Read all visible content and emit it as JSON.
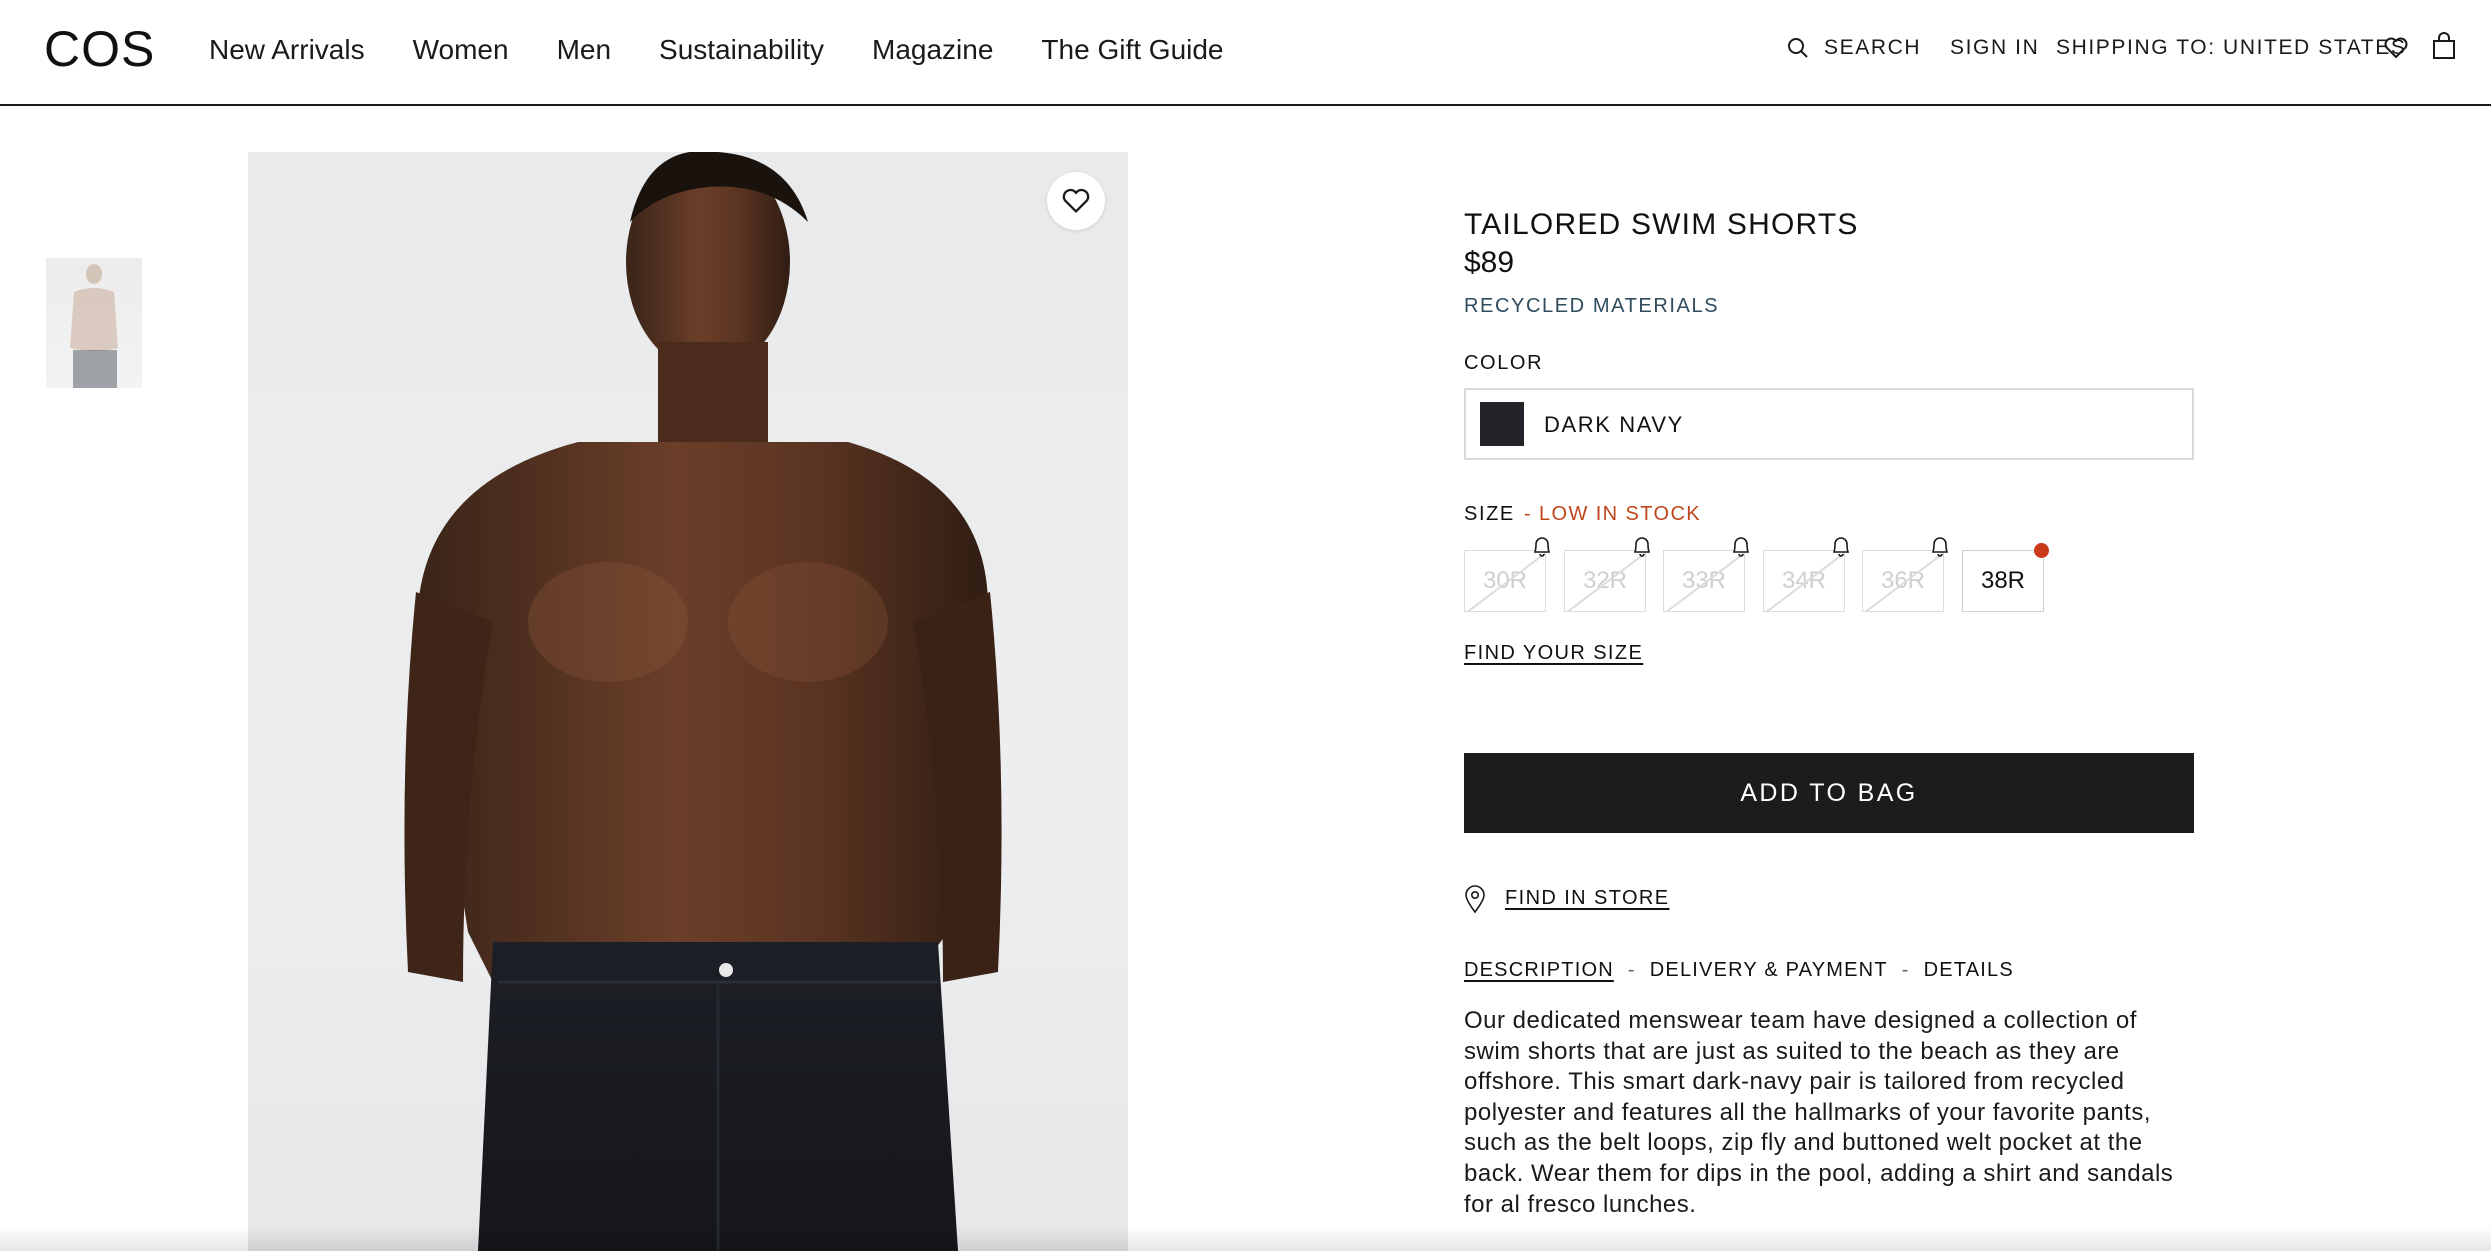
{
  "header": {
    "logo": "COS",
    "nav": [
      "New Arrivals",
      "Women",
      "Men",
      "Sustainability",
      "Magazine",
      "The Gift Guide"
    ],
    "search_label": "SEARCH",
    "sign_in_label": "SIGN IN",
    "shipping_label": "SHIPPING TO: UNITED STATES"
  },
  "product": {
    "title": "TAILORED SWIM SHORTS",
    "price": "$89",
    "tag": "RECYCLED MATERIALS",
    "color_label": "COLOR",
    "color_value": "DARK NAVY",
    "swatch_color": "#22242a",
    "size_label": "SIZE",
    "stock_note": "- LOW IN STOCK",
    "sizes": [
      {
        "label": "30R",
        "available": false
      },
      {
        "label": "32R",
        "available": false
      },
      {
        "label": "33R",
        "available": false
      },
      {
        "label": "34R",
        "available": false
      },
      {
        "label": "36R",
        "available": false
      },
      {
        "label": "38R",
        "available": true
      }
    ],
    "find_size_label": "FIND YOUR SIZE",
    "add_to_bag_label": "ADD TO BAG",
    "find_in_store_label": "FIND IN STORE",
    "tabs": [
      "DESCRIPTION",
      "DELIVERY & PAYMENT",
      "DETAILS"
    ],
    "active_tab": "DESCRIPTION",
    "description": "Our dedicated menswear team have designed a collection of swim shorts that are just as suited to the beach as they are offshore. This smart dark-navy pair is tailored from recycled polyester and features all the hallmarks of your favorite pants, such as the belt loops, zip fly and buttoned welt pocket at the back. Wear them for dips in the pool, adding a shirt and sandals for al fresco lunches."
  },
  "colors": {
    "accent_low_stock": "#c0471b",
    "tag_color": "#2f4b5e",
    "button_bg": "#1c1c1c"
  }
}
